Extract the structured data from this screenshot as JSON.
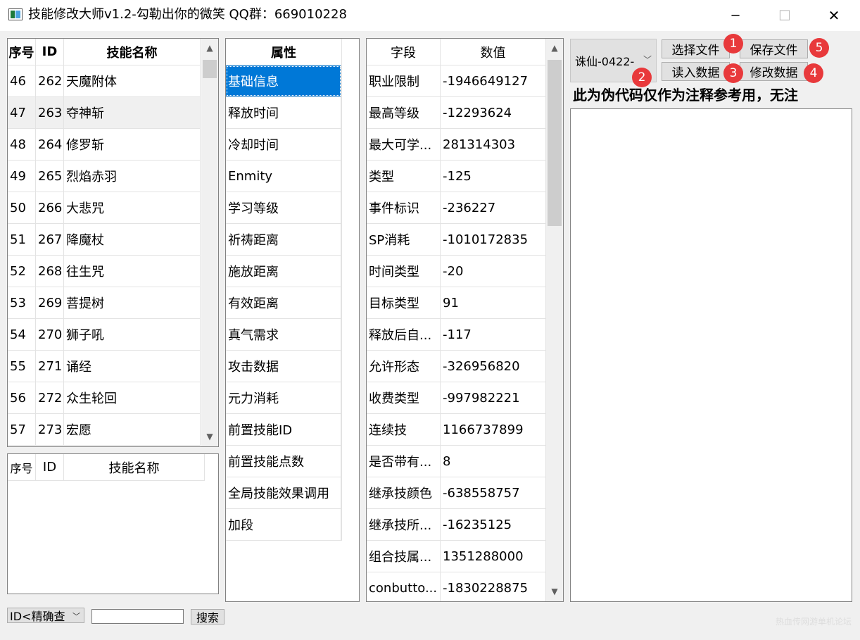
{
  "window": {
    "title": "技能修改大师v1.2-勾勒出你的微笑 QQ群：669010228",
    "minimize_glyph": "─",
    "maximize_glyph": "☐",
    "close_glyph": "✕"
  },
  "skill_list": {
    "headers": [
      "序号",
      "ID",
      "技能名称"
    ],
    "rows": [
      {
        "no": "46",
        "id": "262",
        "name": "天魔附体"
      },
      {
        "no": "47",
        "id": "263",
        "name": "夺神斩"
      },
      {
        "no": "48",
        "id": "264",
        "name": "修罗斩"
      },
      {
        "no": "49",
        "id": "265",
        "name": "烈焰赤羽"
      },
      {
        "no": "50",
        "id": "266",
        "name": "大悲咒"
      },
      {
        "no": "51",
        "id": "267",
        "name": "降魔杖"
      },
      {
        "no": "52",
        "id": "268",
        "name": "往生咒"
      },
      {
        "no": "53",
        "id": "269",
        "name": "菩提树"
      },
      {
        "no": "54",
        "id": "270",
        "name": "狮子吼"
      },
      {
        "no": "55",
        "id": "271",
        "name": "诵经"
      },
      {
        "no": "56",
        "id": "272",
        "name": "众生轮回"
      },
      {
        "no": "57",
        "id": "273",
        "name": "宏愿"
      }
    ]
  },
  "search_results": {
    "headers": [
      "序号",
      "ID",
      "技能名称"
    ]
  },
  "attributes": {
    "header": "属性",
    "items": [
      "基础信息",
      "释放时间",
      "冷却时间",
      "Enmity",
      "学习等级",
      "祈祷距离",
      "施放距离",
      "有效距离",
      "真气需求",
      "攻击数据",
      "元力消耗",
      "前置技能ID",
      "前置技能点数",
      "全局技能效果调用",
      "加段"
    ],
    "selected_index": 0
  },
  "fields": {
    "headers": [
      "字段",
      "数值"
    ],
    "rows": [
      {
        "field": "职业限制",
        "value": "-1946649127"
      },
      {
        "field": "最高等级",
        "value": "-12293624"
      },
      {
        "field": "最大可学...",
        "value": "281314303"
      },
      {
        "field": "类型",
        "value": "-125"
      },
      {
        "field": "事件标识",
        "value": "-236227"
      },
      {
        "field": "SP消耗",
        "value": "-1010172835"
      },
      {
        "field": "时间类型",
        "value": "-20"
      },
      {
        "field": "目标类型",
        "value": "91"
      },
      {
        "field": "释放后自...",
        "value": "-117"
      },
      {
        "field": "允许形态",
        "value": "-326956820"
      },
      {
        "field": "收费类型",
        "value": "-997982221"
      },
      {
        "field": "连续技",
        "value": "1166737899"
      },
      {
        "field": "是否带有...",
        "value": "8"
      },
      {
        "field": "继承技颜色",
        "value": "-638558757"
      },
      {
        "field": "继承技所...",
        "value": "-16235125"
      },
      {
        "field": "组合技属...",
        "value": "1351288000"
      },
      {
        "field": "conbutto...",
        "value": "-1830228875"
      }
    ]
  },
  "toolbar": {
    "version_select": "诛仙-0422-",
    "select_file": "选择文件",
    "save_file": "保存文件",
    "read_data": "读入数据",
    "modify_data": "修改数据",
    "badges": [
      "1",
      "2",
      "3",
      "4",
      "5"
    ]
  },
  "note_text": "此为伪代码仅作为注释参考用，无注",
  "search": {
    "mode": "ID<精确查",
    "input_value": "",
    "button": "搜索"
  },
  "watermark": "热血传网游单机论坛",
  "colors": {
    "selection": "#0078d7",
    "badge": "#e8393b"
  }
}
